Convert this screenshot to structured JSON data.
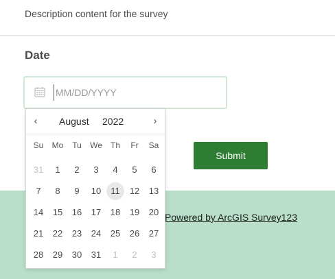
{
  "survey": {
    "description": "Description content for the survey"
  },
  "question": {
    "label": "Date",
    "placeholder": "MM/DD/YYYY",
    "value": ""
  },
  "datepicker": {
    "month": "August",
    "year": "2022",
    "weekdays": [
      "Su",
      "Mo",
      "Tu",
      "We",
      "Th",
      "Fr",
      "Sa"
    ],
    "weeks": [
      [
        {
          "d": "31",
          "muted": true
        },
        {
          "d": "1"
        },
        {
          "d": "2"
        },
        {
          "d": "3"
        },
        {
          "d": "4"
        },
        {
          "d": "5"
        },
        {
          "d": "6"
        }
      ],
      [
        {
          "d": "7"
        },
        {
          "d": "8"
        },
        {
          "d": "9"
        },
        {
          "d": "10"
        },
        {
          "d": "11",
          "today": true
        },
        {
          "d": "12"
        },
        {
          "d": "13"
        }
      ],
      [
        {
          "d": "14"
        },
        {
          "d": "15"
        },
        {
          "d": "16"
        },
        {
          "d": "17"
        },
        {
          "d": "18"
        },
        {
          "d": "19"
        },
        {
          "d": "20"
        }
      ],
      [
        {
          "d": "21"
        },
        {
          "d": "22"
        },
        {
          "d": "23"
        },
        {
          "d": "24"
        },
        {
          "d": "25"
        },
        {
          "d": "26"
        },
        {
          "d": "27"
        }
      ],
      [
        {
          "d": "28"
        },
        {
          "d": "29"
        },
        {
          "d": "30"
        },
        {
          "d": "31"
        },
        {
          "d": "1",
          "muted": true
        },
        {
          "d": "2",
          "muted": true
        },
        {
          "d": "3",
          "muted": true
        }
      ]
    ],
    "prev_icon": "chevron-left-icon",
    "next_icon": "chevron-right-icon"
  },
  "actions": {
    "submit_label": "Submit"
  },
  "footer": {
    "powered_by": "Powered by ArcGIS Survey123"
  },
  "colors": {
    "accent": "#2f7d32",
    "footer_bg": "#b9dfcb",
    "field_border": "#cfe7d5"
  }
}
